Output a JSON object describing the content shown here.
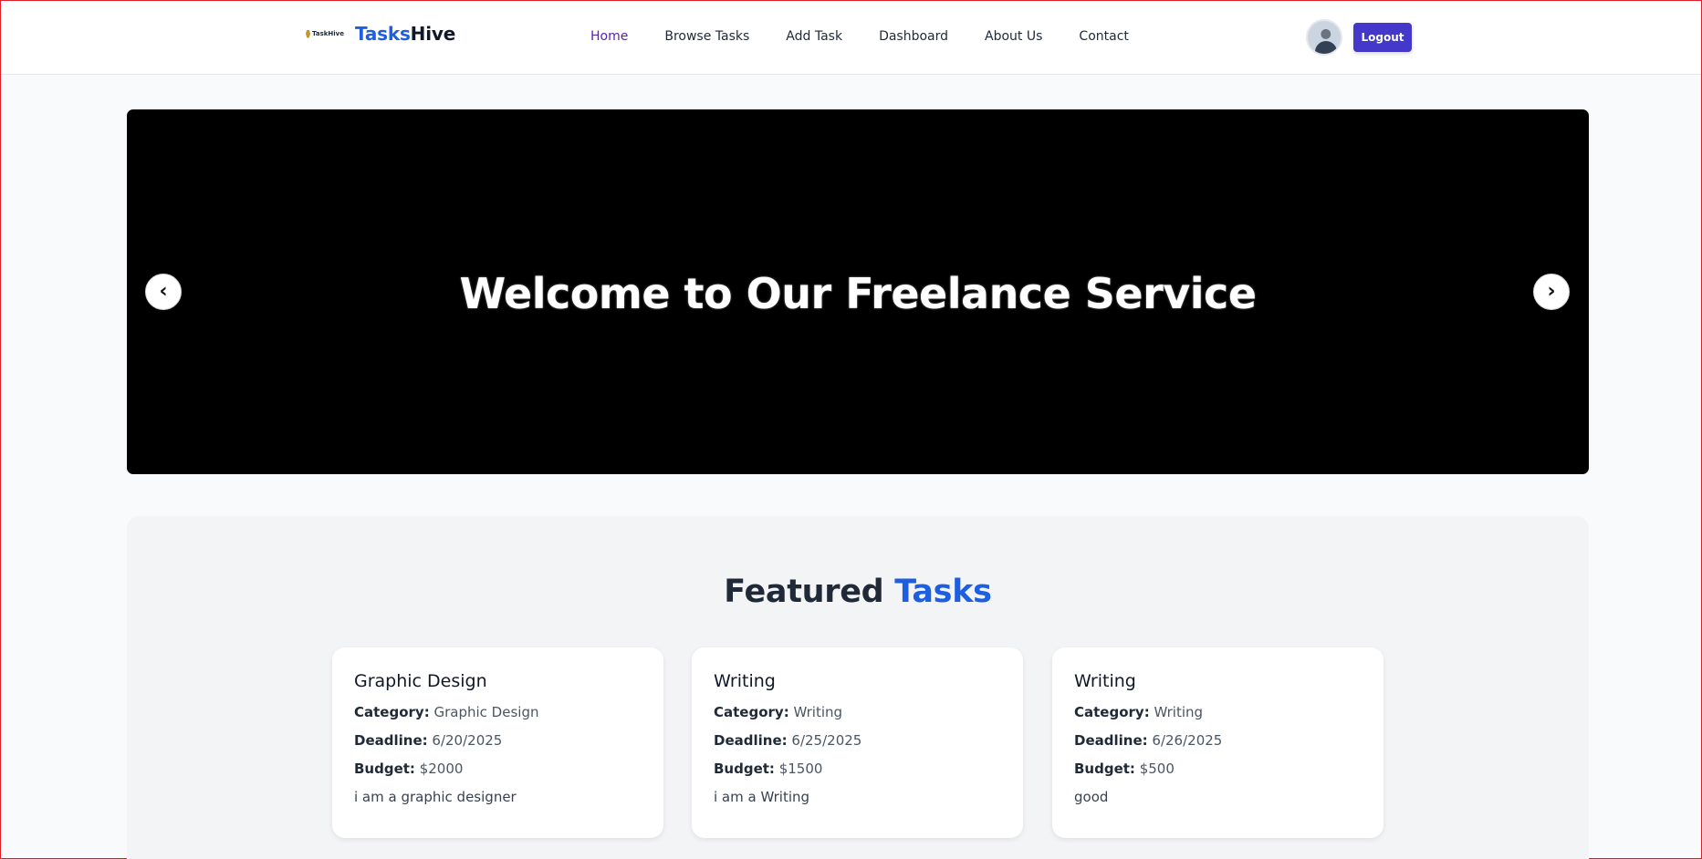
{
  "navbar": {
    "logo_text": "TaskHive",
    "brand_part1": "Tasks",
    "brand_part2": "Hive",
    "links": [
      "Home",
      "Browse Tasks",
      "Add Task",
      "Dashboard",
      "About Us",
      "Contact"
    ],
    "active_link": "Home",
    "logout_label": "Logout"
  },
  "hero": {
    "title": "Welcome to Our Freelance Service",
    "prev_icon": "‹",
    "next_icon": "›"
  },
  "featured": {
    "title_part1": "Featured",
    "title_part2": "Tasks",
    "labels": {
      "category": "Category:",
      "deadline": "Deadline:",
      "budget": "Budget:"
    },
    "cards": [
      {
        "title": "Graphic Design",
        "category": "Graphic Design",
        "deadline": "6/20/2025",
        "budget": "$2000",
        "description": "i am a graphic designer"
      },
      {
        "title": "Writing",
        "category": "Writing",
        "deadline": "6/25/2025",
        "budget": "$1500",
        "description": "i am a Writing"
      },
      {
        "title": "Writing",
        "category": "Writing",
        "deadline": "6/26/2025",
        "budget": "$500",
        "description": "good"
      }
    ]
  },
  "colors": {
    "accent_blue": "#1d5fe0",
    "logout_bg": "#4338ca",
    "active_link": "#5b21b6",
    "hero_bg": "#000000",
    "featured_bg": "#f3f4f6"
  }
}
